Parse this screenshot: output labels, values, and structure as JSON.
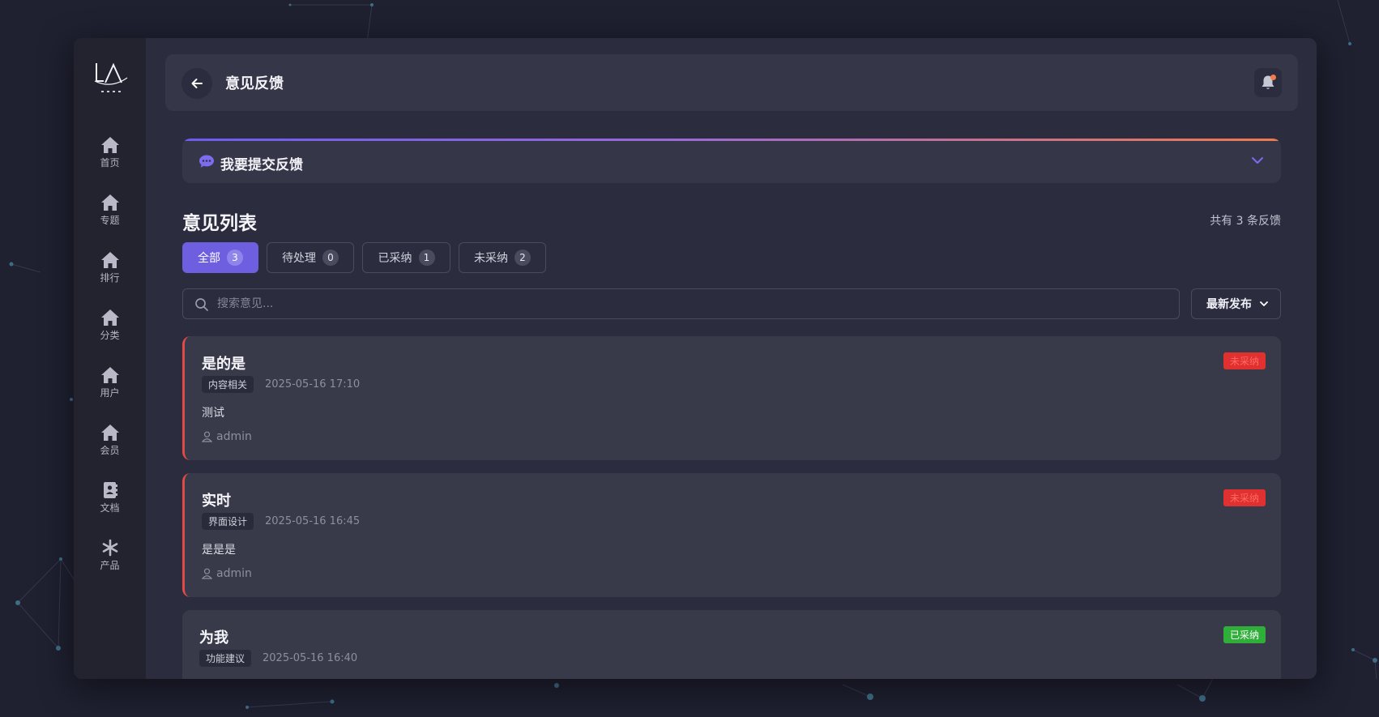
{
  "colors": {
    "accent": "#6d5fe0",
    "rejected": "#e0302f",
    "accepted": "#2faf3a",
    "card_bg": "#383949"
  },
  "sidebar": {
    "logo_text": "LA",
    "items": [
      {
        "label": "首页",
        "icon": "home-icon"
      },
      {
        "label": "专题",
        "icon": "home-icon"
      },
      {
        "label": "排行",
        "icon": "home-icon"
      },
      {
        "label": "分类",
        "icon": "home-icon"
      },
      {
        "label": "用户",
        "icon": "home-icon"
      },
      {
        "label": "会员",
        "icon": "home-icon"
      },
      {
        "label": "文档",
        "icon": "contact-book-icon"
      },
      {
        "label": "产品",
        "icon": "asterisk-icon"
      }
    ]
  },
  "header": {
    "title": "意见反馈",
    "back_icon": "arrow-left-icon",
    "bell_icon": "bell-icon"
  },
  "submit_panel": {
    "label": "我要提交反馈",
    "icon": "chat-bubble-icon",
    "chevron": "chevron-down-icon"
  },
  "list": {
    "title": "意见列表",
    "count_text": "共有 3 条反馈"
  },
  "tabs": [
    {
      "label": "全部",
      "count": "3",
      "active": true
    },
    {
      "label": "待处理",
      "count": "0",
      "active": false
    },
    {
      "label": "已采纳",
      "count": "1",
      "active": false
    },
    {
      "label": "未采纳",
      "count": "2",
      "active": false
    }
  ],
  "search": {
    "placeholder": "搜索意见...",
    "value": ""
  },
  "sort": {
    "selected": "最新发布"
  },
  "feedback": [
    {
      "title": "是的是",
      "category": "内容相关",
      "time": "2025-05-16 17:10",
      "content": "测试",
      "author": "admin",
      "status": "未采纳",
      "status_type": "rejected"
    },
    {
      "title": "实时",
      "category": "界面设计",
      "time": "2025-05-16 16:45",
      "content": "是是是",
      "author": "admin",
      "status": "未采纳",
      "status_type": "rejected"
    },
    {
      "title": "为我",
      "category": "功能建议",
      "time": "2025-05-16 16:40",
      "content": "",
      "author": "",
      "status": "已采纳",
      "status_type": "accepted"
    }
  ]
}
